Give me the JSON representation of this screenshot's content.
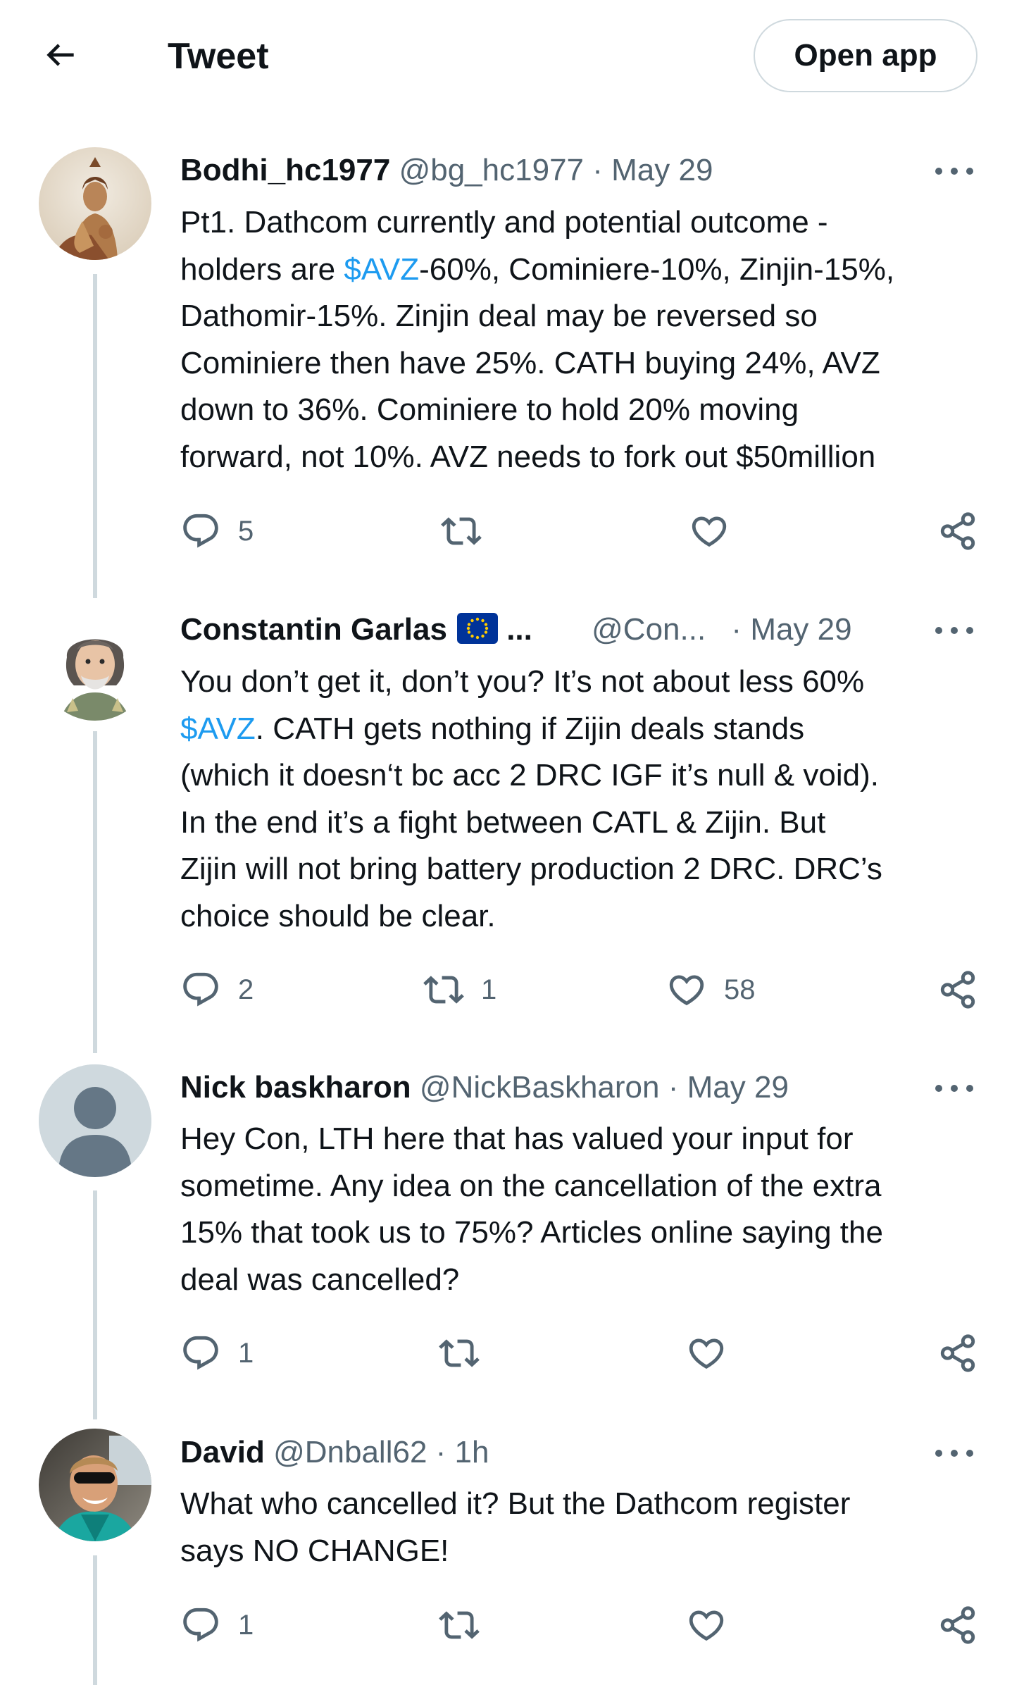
{
  "header": {
    "title": "Tweet",
    "open_app_label": "Open app"
  },
  "tweets": [
    {
      "name": "Bodhi_hc1977",
      "handle": "@bg_hc1977",
      "separator": "·",
      "time": "May 29",
      "lines": [
        [
          {
            "t": "Pt1. Dathcom currently and potential outcome -"
          }
        ],
        [
          {
            "t": "holders are "
          },
          {
            "t": "$AVZ",
            "cash": true
          },
          {
            "t": "-60%, Cominiere-10%, Zinjin-15%,"
          }
        ],
        [
          {
            "t": "Dathomir-15%. Zinjin deal may be reversed so"
          }
        ],
        [
          {
            "t": "Cominiere then have 25%. CATH buying 24%, AVZ"
          }
        ],
        [
          {
            "t": "down to 36%. Cominiere to hold 20% moving"
          }
        ],
        [
          {
            "t": "forward, not 10%. AVZ needs to fork out $50million"
          }
        ]
      ],
      "counts": {
        "reply": "5",
        "retweet": "",
        "like": ""
      }
    },
    {
      "name": "Constantin Garlas",
      "name_suffix": "...",
      "handle": "@Con...",
      "separator": "·",
      "time": "May 29",
      "lines": [
        [
          {
            "t": "You don’t get it, don’t you? It’s not about less 60%"
          }
        ],
        [
          {
            "t": "$AVZ",
            "cash": true
          },
          {
            "t": ". CATH gets nothing if Zijin deals stands"
          }
        ],
        [
          {
            "t": "(which it doesn‘t bc acc 2 DRC IGF it’s null & void)."
          }
        ],
        [
          {
            "t": "In the end it’s a fight between CATL & Zijin. But"
          }
        ],
        [
          {
            "t": "Zijin will not bring battery production 2 DRC. DRC’s"
          }
        ],
        [
          {
            "t": "choice should be clear."
          }
        ]
      ],
      "counts": {
        "reply": "2",
        "retweet": "1",
        "like": "58"
      }
    },
    {
      "name": "Nick baskharon",
      "handle": "@NickBaskharon",
      "separator": "·",
      "time": "May 29",
      "lines": [
        [
          {
            "t": "Hey Con, LTH here that has valued your input for"
          }
        ],
        [
          {
            "t": "sometime. Any idea on the cancellation of the extra"
          }
        ],
        [
          {
            "t": "15% that took us to 75%? Articles online saying the"
          }
        ],
        [
          {
            "t": "deal was cancelled?"
          }
        ]
      ],
      "counts": {
        "reply": "1",
        "retweet": "",
        "like": ""
      }
    },
    {
      "name": "David",
      "handle": "@Dnball62",
      "separator": "·",
      "time": "1h",
      "lines": [
        [
          {
            "t": "What who cancelled it? But the Dathcom register"
          }
        ],
        [
          {
            "t": "says NO CHANGE!"
          }
        ]
      ],
      "counts": {
        "reply": "1",
        "retweet": "",
        "like": ""
      }
    }
  ],
  "colors": {
    "accent": "#1d9bf0",
    "secondary_text": "#536471",
    "thread_line": "#cfd9de",
    "eu_flag": "#003399"
  },
  "icons": [
    "back-arrow-icon",
    "reply-icon",
    "retweet-icon",
    "like-icon",
    "share-icon",
    "more-icon",
    "eu-flag-icon"
  ]
}
